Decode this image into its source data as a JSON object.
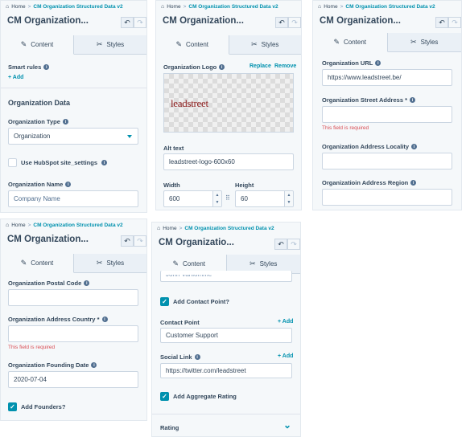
{
  "common": {
    "breadcrumb_home": "Home",
    "breadcrumb_sep": ">",
    "breadcrumb_module": "CM Organization Structured Data v2",
    "title": "CM Organization...",
    "title_short": "CM Organizatio...",
    "tab_content": "Content",
    "tab_styles": "Styles",
    "undo_icon": "↶",
    "redo_icon": "↷",
    "info_glyph": "i",
    "check_glyph": "✓",
    "field_required_error": "This field is required"
  },
  "panel1": {
    "smart_rules_label": "Smart rules",
    "add_label": "+ Add",
    "section_heading": "Organization Data",
    "org_type_label": "Organization Type",
    "org_type_value": "Organization",
    "use_hubspot_label": "Use HubSpot site_settings",
    "org_name_label": "Organization Name",
    "org_name_placeholder": "Company Name"
  },
  "panel2": {
    "logo_label": "Organization Logo",
    "replace_label": "Replace",
    "remove_label": "Remove",
    "logo_image_text": "leadstreet",
    "alt_text_label": "Alt text",
    "alt_text_value": "leadstreet-logo-600x60",
    "width_label": "Width",
    "width_value": "600",
    "height_label": "Height",
    "height_value": "60",
    "stepper_up": "▲",
    "stepper_down": "▼",
    "lock_glyph": "⠿"
  },
  "panel3": {
    "url_label": "Organization URL",
    "url_value": "https://www.leadstreet.be/",
    "street_label": "Organization Street Address *",
    "locality_label": "Organization Address Locality",
    "region_label": "Organizatioin Address Region"
  },
  "panel4": {
    "postal_label": "Organization Postal Code",
    "country_label": "Organization Address Country *",
    "founding_label": "Organization Founding Date",
    "founding_value": "2020-07-04",
    "add_founders_label": "Add Founders?"
  },
  "panel5": {
    "clipped_value": "John Vanlomme",
    "add_contact_label": "Add Contact Point?",
    "contact_point_label": "Contact Point",
    "contact_add": "+ Add",
    "contact_value": "Customer Support",
    "social_link_label": "Social Link",
    "social_add": "+ Add",
    "social_value": "https://twitter.com/leadstreet",
    "add_rating_label": "Add Aggregate Rating",
    "rating_label": "Rating",
    "chevron_icon": "⌄"
  },
  "icons": {
    "home": "⌂",
    "pencil": "✎",
    "styles": "✂"
  },
  "colors": {
    "accent": "#0091ae",
    "error": "#d94c53",
    "text": "#33475b",
    "panel_bg": "#f5f8fa"
  }
}
